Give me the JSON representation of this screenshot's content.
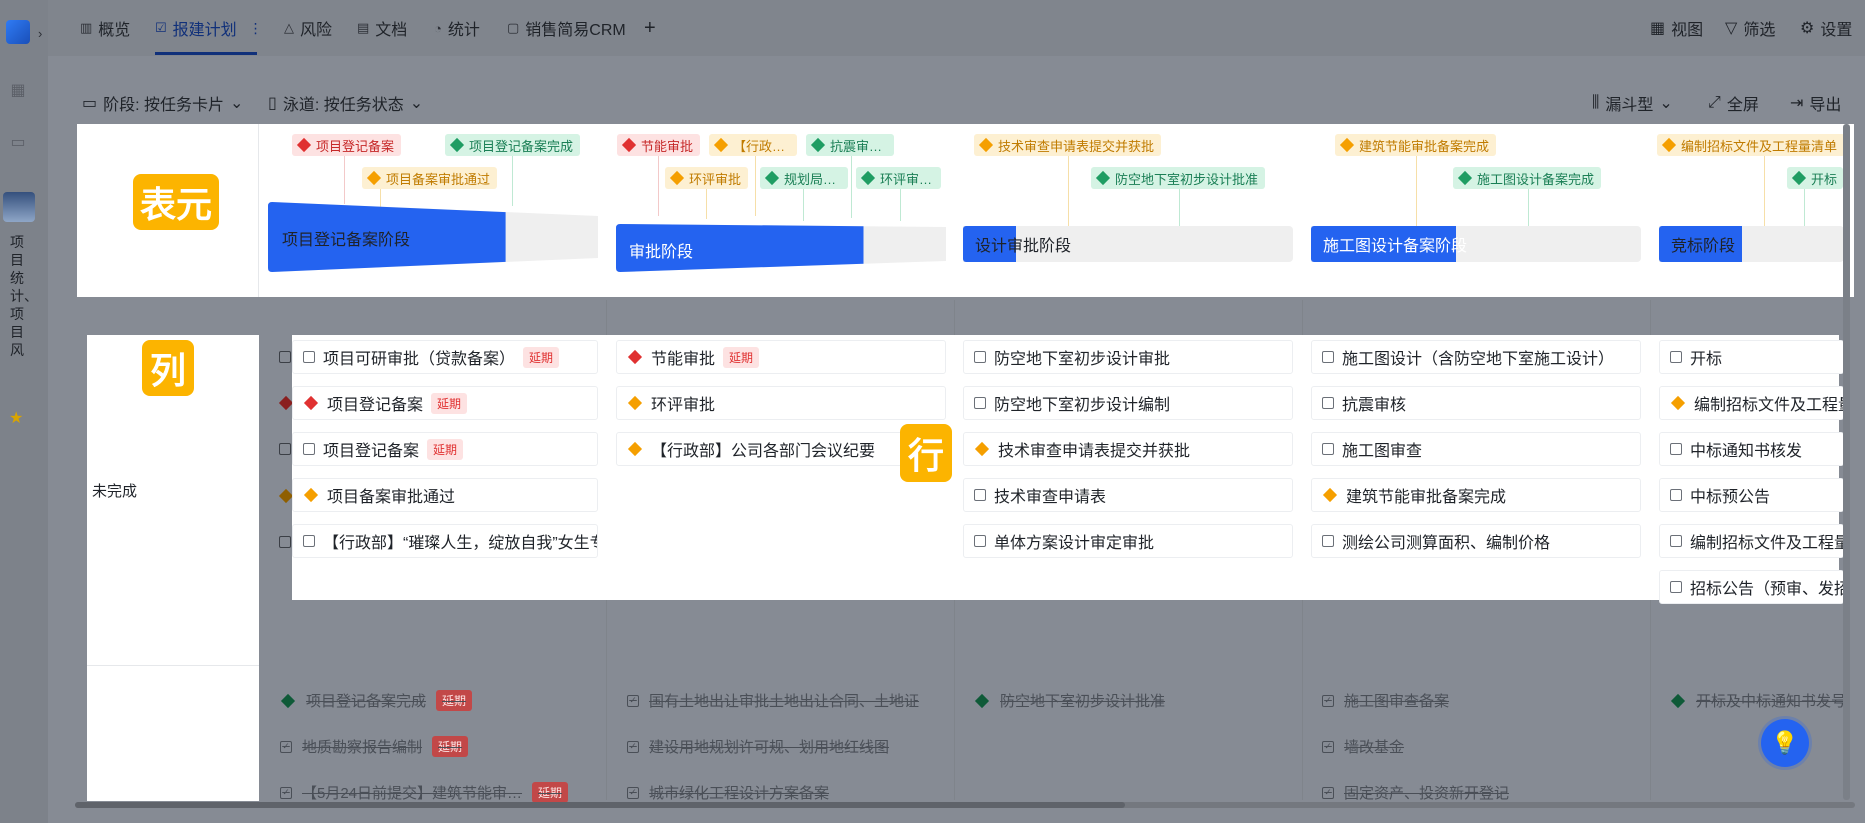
{
  "rail": {
    "vertical_label": "项目统计、项目风",
    "badge_label": ""
  },
  "tabs": [
    {
      "label": "概览",
      "icon": "chart-icon"
    },
    {
      "label": "报建计划",
      "icon": "check-square-icon",
      "active": true
    },
    {
      "label": "风险",
      "icon": "warning-icon"
    },
    {
      "label": "文档",
      "icon": "document-icon"
    },
    {
      "label": "统计",
      "icon": "pie-icon"
    },
    {
      "label": "销售简易CRM",
      "icon": "file-icon"
    }
  ],
  "tab_more": "⋮",
  "tab_add": "+",
  "toolbar": {
    "view": "视图",
    "filter": "筛选",
    "settings": "设置"
  },
  "subbar": {
    "stage": "阶段: 按任务卡片",
    "lane": "泳道: 按任务状态",
    "funnel": "漏斗型",
    "fullscreen": "全屏",
    "export": "导出"
  },
  "badges": {
    "header": "表元",
    "column": "列",
    "row": "行"
  },
  "milestones": [
    {
      "label": "项目登记备案",
      "color": "red"
    },
    {
      "label": "项目登记备案完成",
      "color": "green"
    },
    {
      "label": "项目备案审批通过",
      "color": "amber"
    },
    {
      "label": "节能审批",
      "color": "red"
    },
    {
      "label": "【行政…",
      "color": "amber"
    },
    {
      "label": "抗震审…",
      "color": "green"
    },
    {
      "label": "环评审批",
      "color": "amber"
    },
    {
      "label": "规划局…",
      "color": "green"
    },
    {
      "label": "环评审…",
      "color": "green"
    },
    {
      "label": "技术审查申请表提交并获批",
      "color": "amber"
    },
    {
      "label": "防空地下室初步设计批准",
      "color": "green"
    },
    {
      "label": "建筑节能审批备案完成",
      "color": "amber"
    },
    {
      "label": "施工图设计备案完成",
      "color": "green"
    },
    {
      "label": "编制招标文件及工程量清单",
      "color": "amber"
    },
    {
      "label": "开标",
      "color": "green"
    }
  ],
  "stages": [
    {
      "label": "项目登记备案阶段",
      "progress": 0.72
    },
    {
      "label": "审批阶段",
      "progress": 0.75
    },
    {
      "label": "设计审批阶段",
      "progress": 0.16
    },
    {
      "label": "施工图设计备案阶段",
      "progress": 0.44
    },
    {
      "label": "竞标阶段",
      "progress": 0.25
    }
  ],
  "lane_label": "未完成",
  "columns": [
    {
      "cards": [
        {
          "icon": "checkbox",
          "text": "项目可研审批（贷款备案）",
          "tag": "延期"
        },
        {
          "icon": "diamond-red",
          "text": "项目登记备案",
          "tag": "延期"
        },
        {
          "icon": "checkbox",
          "text": "项目登记备案",
          "tag": "延期"
        },
        {
          "icon": "diamond-amber",
          "text": "项目备案审批通过",
          "tag": ""
        },
        {
          "icon": "checkbox",
          "text": "【行政部】“璀璨人生，绽放自我”女生专…",
          "tag": ""
        }
      ]
    },
    {
      "cards": [
        {
          "icon": "diamond-red",
          "text": "节能审批",
          "tag": "延期"
        },
        {
          "icon": "diamond-amber",
          "text": "环评审批",
          "tag": ""
        },
        {
          "icon": "diamond-amber",
          "text": "【行政部】公司各部门会议纪要",
          "tag": ""
        }
      ]
    },
    {
      "cards": [
        {
          "icon": "checkbox",
          "text": "防空地下室初步设计审批",
          "tag": ""
        },
        {
          "icon": "checkbox",
          "text": "防空地下室初步设计编制",
          "tag": ""
        },
        {
          "icon": "diamond-amber",
          "text": "技术审查申请表提交并获批",
          "tag": ""
        },
        {
          "icon": "checkbox",
          "text": "技术审查申请表",
          "tag": ""
        },
        {
          "icon": "checkbox",
          "text": "单体方案设计审定审批",
          "tag": ""
        }
      ]
    },
    {
      "cards": [
        {
          "icon": "checkbox",
          "text": "施工图设计（含防空地下室施工设计）",
          "tag": ""
        },
        {
          "icon": "checkbox",
          "text": "抗震审核",
          "tag": ""
        },
        {
          "icon": "checkbox",
          "text": "施工图审查",
          "tag": ""
        },
        {
          "icon": "diamond-amber",
          "text": "建筑节能审批备案完成",
          "tag": ""
        },
        {
          "icon": "checkbox",
          "text": "测绘公司测算面积、编制价格",
          "tag": ""
        }
      ]
    },
    {
      "cards": [
        {
          "icon": "checkbox",
          "text": "开标",
          "tag": ""
        },
        {
          "icon": "diamond-amber",
          "text": "编制招标文件及工程量",
          "tag": ""
        },
        {
          "icon": "checkbox",
          "text": "中标通知书核发",
          "tag": ""
        },
        {
          "icon": "checkbox",
          "text": "中标预公告",
          "tag": ""
        },
        {
          "icon": "checkbox",
          "text": "编制招标文件及工程量",
          "tag": ""
        },
        {
          "icon": "checkbox",
          "text": "招标公告（预审、发招",
          "tag": ""
        }
      ]
    }
  ],
  "done_columns": [
    [
      {
        "icon": "diamond-green",
        "text": "项目登记备案完成",
        "tag": "延期"
      },
      {
        "icon": "check",
        "text": "地质勘察报告编制",
        "tag": "延期"
      },
      {
        "icon": "check",
        "text": "【5月24日前提交】建筑节能审…",
        "tag": "延期"
      }
    ],
    [
      {
        "icon": "check",
        "text": "国有土地出让审批土地出让合同、土地证",
        "tag": ""
      },
      {
        "icon": "check",
        "text": "建设用地规划许可规、划用地红线图",
        "tag": ""
      },
      {
        "icon": "check",
        "text": "城市绿化工程设计方案备案",
        "tag": ""
      }
    ],
    [
      {
        "icon": "diamond-green",
        "text": "防空地下室初步设计批准",
        "tag": ""
      }
    ],
    [
      {
        "icon": "check",
        "text": "施工图审查备案",
        "tag": ""
      },
      {
        "icon": "check",
        "text": "墙改基金",
        "tag": ""
      },
      {
        "icon": "check",
        "text": "固定资产、投资新开登记",
        "tag": ""
      }
    ],
    [
      {
        "icon": "diamond-green",
        "text": "开标及中标通知书发号",
        "tag": ""
      }
    ]
  ]
}
